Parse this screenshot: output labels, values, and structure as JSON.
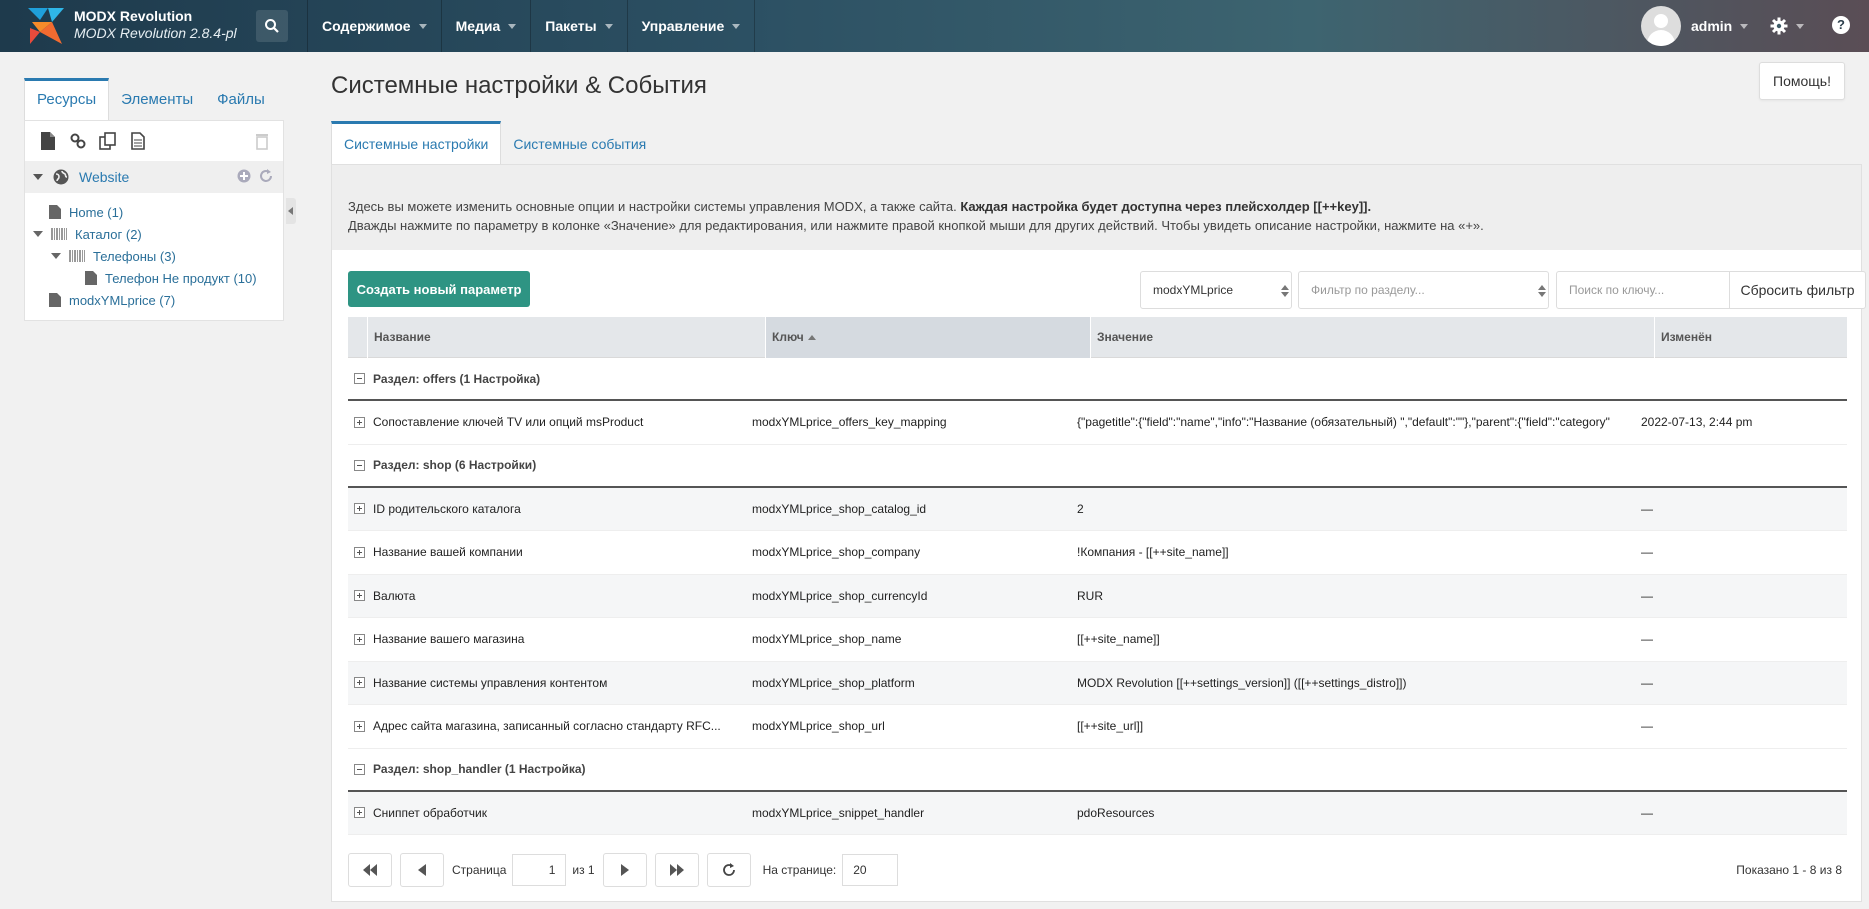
{
  "header": {
    "brand_title": "MODX Revolution",
    "brand_version": "MODX Revolution 2.8.4-pl",
    "nav": [
      "Содержимое",
      "Медиа",
      "Пакеты",
      "Управление"
    ],
    "username": "admin",
    "help_icon": "?"
  },
  "sidebar": {
    "tabs": [
      "Ресурсы",
      "Элементы",
      "Файлы"
    ],
    "root_label": "Website",
    "tree": [
      {
        "label": "Home (1)"
      },
      {
        "label": "Каталог (2)"
      },
      {
        "label": "Телефоны (3)"
      },
      {
        "label": "Телефон Не продукт (10)"
      },
      {
        "label": "modxYMLprice (7)"
      }
    ]
  },
  "page": {
    "title": "Системные настройки & События",
    "help_button": "Помощь!",
    "tabs": [
      "Системные настройки",
      "Системные события"
    ],
    "desc_line1": "Здесь вы можете изменить основные опции и настройки системы управления MODX, а также сайта.",
    "desc_line1_bold": "Каждая настройка будет доступна через плейсхолдер [[++key]].",
    "desc_line2": "Дважды нажмите по параметру в колонке «Значение» для редактирования, или нажмите правой кнопкой мыши для других действий. Чтобы увидеть описание настройки, нажмите на «+»."
  },
  "toolbar": {
    "create_button": "Создать новый параметр",
    "namespace_value": "modxYMLprice",
    "area_placeholder": "Фильтр по разделу...",
    "search_placeholder": "Поиск по ключу...",
    "reset_button": "Сбросить фильтр"
  },
  "grid": {
    "columns": [
      "Название",
      "Ключ",
      "Значение",
      "Изменён"
    ],
    "groups": [
      {
        "label": "Раздел: offers (1 Настройка)",
        "rows": [
          {
            "name": "Сопоставление ключей TV или опций msProduct",
            "key": "modxYMLprice_offers_key_mapping",
            "value": "{\"pagetitle\":{\"field\":\"name\",\"info\":\"Название (обязательный) \",\"default\":\"\"},\"parent\":{\"field\":\"category\"",
            "edited": "2022-07-13, 2:44 pm"
          }
        ]
      },
      {
        "label": "Раздел: shop (6 Настройки)",
        "rows": [
          {
            "name": "ID родительского каталога",
            "key": "modxYMLprice_shop_catalog_id",
            "value": "2",
            "edited": "—"
          },
          {
            "name": "Название вашей компании",
            "key": "modxYMLprice_shop_company",
            "value": "!Компания - [[++site_name]]",
            "edited": "—"
          },
          {
            "name": "Валюта",
            "key": "modxYMLprice_shop_currencyId",
            "value": "RUR",
            "edited": "—"
          },
          {
            "name": "Название вашего магазина",
            "key": "modxYMLprice_shop_name",
            "value": "[[++site_name]]",
            "edited": "—"
          },
          {
            "name": "Название системы управления контентом",
            "key": "modxYMLprice_shop_platform",
            "value": "MODX Revolution [[++settings_version]] ([[++settings_distro]])",
            "edited": "—"
          },
          {
            "name": "Адрес сайта магазина, записанный согласно стандарту RFC...",
            "key": "modxYMLprice_shop_url",
            "value": "[[++site_url]]",
            "edited": "—"
          }
        ]
      },
      {
        "label": "Раздел: shop_handler (1 Настройка)",
        "rows": [
          {
            "name": "Сниппет обработчик",
            "key": "modxYMLprice_snippet_handler",
            "value": "pdoResources",
            "edited": "—"
          }
        ]
      }
    ]
  },
  "pager": {
    "page_label": "Страница",
    "page_value": "1",
    "of_label": "из 1",
    "per_page_label": "На странице:",
    "per_page_value": "20",
    "showing": "Показано 1 - 8 из 8"
  }
}
